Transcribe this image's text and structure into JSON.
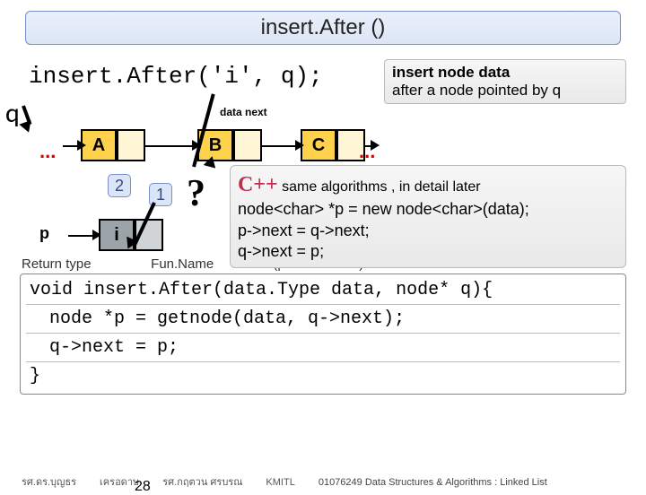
{
  "title": "insert.After ()",
  "call_expr": "insert.After('i', q);",
  "q_label": "q",
  "p_label": "p",
  "data_next": "data next",
  "dots": "...",
  "nodes": {
    "A": "A",
    "B": "B",
    "C": "C",
    "I": "i"
  },
  "badge2": "2",
  "badge1": "1",
  "qmark": "?",
  "note": {
    "line1": "insert node data",
    "line2": "after a node pointed by q"
  },
  "cpp": {
    "tag": "C++",
    "tag_rest": " same algorithms , in detail later",
    "l1": "node<char> *p = new node<char>(data);",
    "l2": "p->next = q->next;",
    "l3": "q->next = p;"
  },
  "labels": {
    "ret": "Return type",
    "fun": "Fun.Name",
    "param": "(parameter list)"
  },
  "code": {
    "l1": "void insert.After(data.Type data, node* q){",
    "l2": "node *p = getnode(data, q->next);",
    "l3": "q->next = p;",
    "l4": "}"
  },
  "footer": {
    "a": "รศ.ดร.บุญธร",
    "b": "เครอดาษ",
    "c": "รศ.กฤตวน  ศรบรณ",
    "d": "KMITL",
    "e": "01076249 Data Structures & Algorithms  : Linked List"
  },
  "slide_num": "28"
}
